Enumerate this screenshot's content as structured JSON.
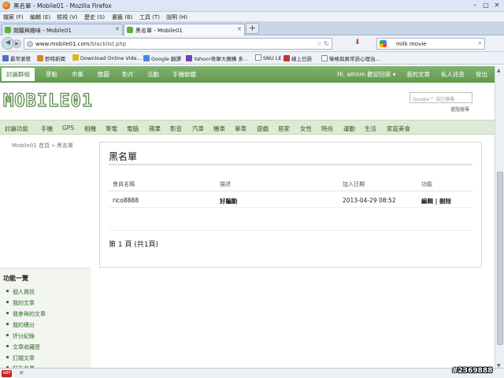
{
  "window": {
    "title": "黑名單 - Mobile01 - Mozilla Firefox",
    "min": "–",
    "max": "□",
    "close": "✕"
  },
  "menu": [
    "檔案 (F)",
    "編輯 (E)",
    "檢視 (V)",
    "歷史 (S)",
    "書籤 (B)",
    "工具 (T)",
    "說明 (H)"
  ],
  "tabs": [
    {
      "label": "閱聽與趣味 - Mobile01",
      "active": false
    },
    {
      "label": "黑名單 - Mobile01",
      "active": true
    }
  ],
  "newtab": "+",
  "nav": {
    "back": "◀",
    "fwd": "▶",
    "url_domain": "www.mobile01.com",
    "url_path": "/blacklist.php",
    "star": "☆",
    "reload": "↻",
    "download": "⬇",
    "search_value": "milk movie",
    "search_icon": "⌕"
  },
  "bookmarks": [
    {
      "label": "最常瀏覽",
      "color": "#4a74c4"
    },
    {
      "label": "即時新聞",
      "color": "#d08a2a"
    },
    {
      "label": "Download Online Vide...",
      "color": "#e0b620"
    },
    {
      "label": "Google 翻譯",
      "color": "#4a86e8"
    },
    {
      "label": "Yahoo!奇摩大團購 多...",
      "color": "#7b3fb0"
    },
    {
      "label": "SNU LE",
      "color": "#888"
    },
    {
      "label": "線上日語",
      "color": "#c33"
    },
    {
      "label": "榮格與異常語心理治...",
      "color": "#888"
    }
  ],
  "sitenav": [
    "討論群組",
    "景點",
    "市集",
    "酷圖",
    "影片",
    "活動",
    "手機軟體"
  ],
  "user": {
    "greeting": "Hi, alhnm 歡迎回來 ▾",
    "links": [
      "我的文章",
      "私人訊息",
      "登出"
    ]
  },
  "header": {
    "logo": "MOBILE01",
    "search_placeholder": "Google™ 自訂搜尋",
    "adv": "進階搜尋"
  },
  "categories": [
    "討論功能",
    "手機",
    "GPS",
    "相機",
    "筆電",
    "電腦",
    "蘋果",
    "影音",
    "汽車",
    "機車",
    "單車",
    "遊戲",
    "居家",
    "女性",
    "時尚",
    "運動",
    "生活",
    "家庭美食"
  ],
  "breadcrumb": "Mobile01 首頁 » 黑名單",
  "content": {
    "title": "黑名單",
    "columns": [
      "會員名稱",
      "描述",
      "加入日期",
      "功能"
    ],
    "rows": [
      {
        "member": "rico8888",
        "desc": "好騙勳",
        "date": "2013-04-29 08:52",
        "actions": "編輯 | 刪除"
      }
    ],
    "pager": "第 1 頁 (共1頁)"
  },
  "leftpanel": {
    "title": "功能一覽",
    "items": [
      "個人資訊",
      "我的文章",
      "我參與的文章",
      "我的積分",
      "評分紀錄",
      "文章收藏匣",
      "訂閱文章",
      "好友名單"
    ]
  },
  "status": {
    "abp": "ABP",
    "close": "✕"
  },
  "watermark": "#2369888"
}
